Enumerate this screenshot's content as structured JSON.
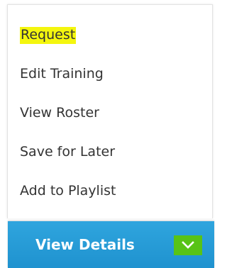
{
  "menu": {
    "items": [
      {
        "label": "Request"
      },
      {
        "label": "Edit Training"
      },
      {
        "label": "View Roster"
      },
      {
        "label": "Save for Later"
      },
      {
        "label": "Add to Playlist"
      }
    ]
  },
  "action_bar": {
    "label": "View Details",
    "toggle_icon": "chevron-down-icon"
  },
  "colors": {
    "highlight": "#f4f60e",
    "action_bar": "#2a9fda",
    "toggle": "#58c316",
    "text": "#333333"
  }
}
